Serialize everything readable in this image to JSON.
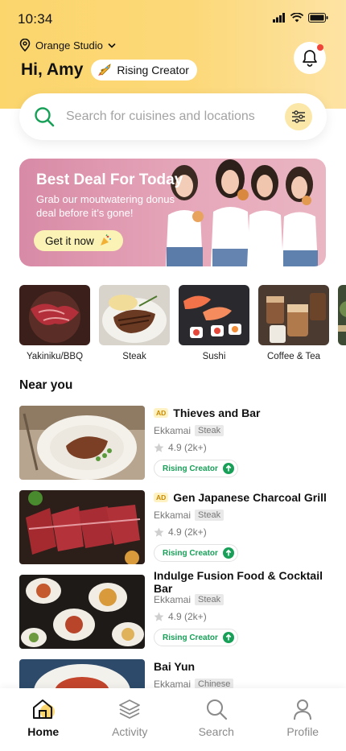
{
  "status": {
    "time": "10:34"
  },
  "header": {
    "location": "Orange Studio",
    "greeting": "Hi, Amy",
    "badge": "Rising Creator"
  },
  "search": {
    "placeholder": "Search for cuisines and locations"
  },
  "banner": {
    "title": "Best Deal For Today",
    "subtitle": "Grab our moutwatering donus deal before it’s gone!",
    "cta": "Get it now"
  },
  "categories": [
    {
      "label": "Yakiniku/BBQ"
    },
    {
      "label": "Steak"
    },
    {
      "label": "Sushi"
    },
    {
      "label": "Coffee & Tea"
    }
  ],
  "near_title": "Near you",
  "restaurants": [
    {
      "ad": "AD",
      "name": "Thieves and Bar",
      "area": "Ekkamai",
      "tag": "Steak",
      "rating": "4.9 (2k+)",
      "creator": "Rising Creator"
    },
    {
      "ad": "AD",
      "name": "Gen Japanese Charcoal Grill",
      "area": "Ekkamai",
      "tag": "Steak",
      "rating": "4.9 (2k+)",
      "creator": "Rising Creator"
    },
    {
      "name": "Indulge Fusion Food & Cocktail Bar",
      "area": "Ekkamai",
      "tag": "Steak",
      "rating": "4.9 (2k+)",
      "creator": "Rising Creator"
    },
    {
      "name": "Bai Yun",
      "area": "Ekkamai",
      "tag": "Chinese"
    }
  ],
  "tabs": [
    {
      "label": "Home",
      "icon": "home-icon",
      "active": true
    },
    {
      "label": "Activity",
      "icon": "layers-icon"
    },
    {
      "label": "Search",
      "icon": "search-icon"
    },
    {
      "label": "Profile",
      "icon": "profile-icon"
    }
  ],
  "colors": {
    "accent": "#fbd66d",
    "green": "#18a058",
    "banner": "#d88aa6"
  }
}
